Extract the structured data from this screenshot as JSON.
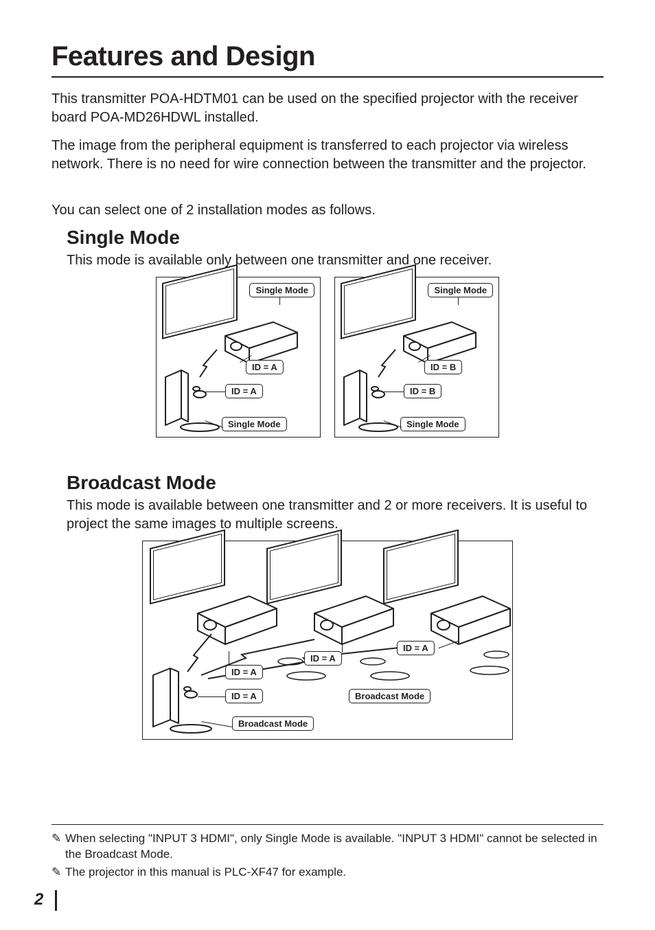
{
  "title": "Features and Design",
  "intro_p1": "This transmitter POA-HDTM01 can be used on the specified projector with the receiver board POA-MD26HDWL installed.",
  "intro_p2": "The image from the peripheral equipment is transferred to each projector via wireless network. There is no need for wire connection between the transmitter and the projector.",
  "select_line": "You can select one of 2 installation modes as follows.",
  "single": {
    "heading": "Single Mode",
    "desc": "This mode is available only between one transmitter and one receiver.",
    "labels": {
      "mode": "Single Mode",
      "id_a": "ID = A",
      "id_b": "ID = B"
    }
  },
  "broadcast": {
    "heading": "Broadcast Mode",
    "desc": "This mode is available between one transmitter and 2 or more receivers. It is useful to project the same images to multiple screens.",
    "labels": {
      "mode": "Broadcast Mode",
      "id_a": "ID = A"
    }
  },
  "footnotes": {
    "n1": "When selecting \"INPUT 3 HDMI\", only Single Mode is available. \"INPUT 3 HDMI\" cannot be selected in the Broadcast Mode.",
    "n2": "The projector in this manual is PLC-XF47 for example."
  },
  "page_number": "2",
  "icons": {
    "pencil": "✎"
  }
}
